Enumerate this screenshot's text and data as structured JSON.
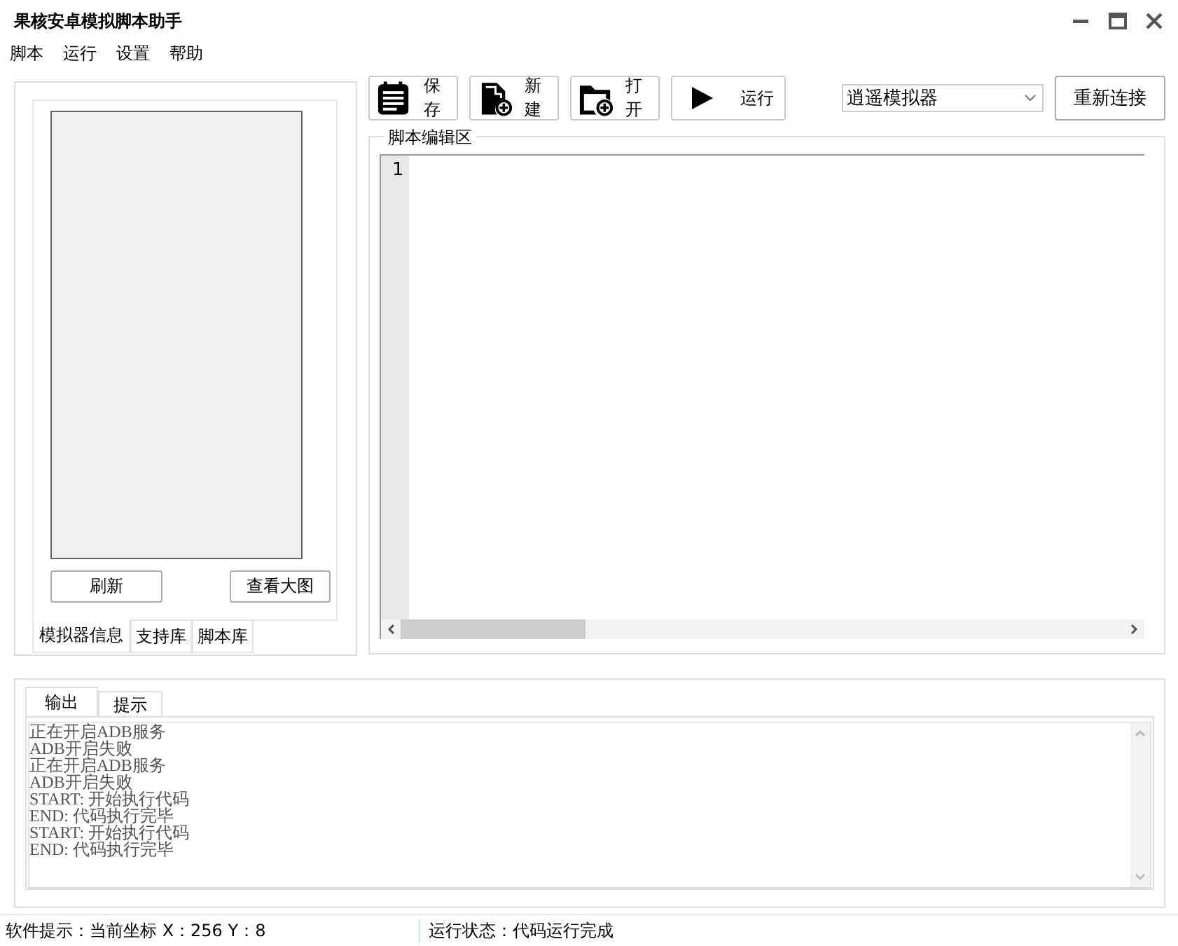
{
  "window": {
    "title": "果核安卓模拟脚本助手"
  },
  "menu": [
    "脚本",
    "运行",
    "设置",
    "帮助"
  ],
  "toolbar": [
    {
      "label": "保存",
      "kind": "save"
    },
    {
      "label": "新建",
      "kind": "new"
    },
    {
      "label": "打开",
      "kind": "open"
    },
    {
      "label": "运行",
      "kind": "run"
    }
  ],
  "emulator_select": {
    "value": "逍遥模拟器"
  },
  "reconnect_button": "重新连接",
  "preview": {
    "buttons": [
      "刷新",
      "查看大图"
    ],
    "tabs": [
      {
        "label": "模拟器信息",
        "selected": true
      },
      {
        "label": "支持库",
        "selected": false
      },
      {
        "label": "脚本库",
        "selected": false
      }
    ]
  },
  "editor": {
    "title": "脚本编辑区",
    "line_numbers": [
      "1"
    ]
  },
  "output": {
    "tabs": [
      {
        "label": "输出",
        "selected": true
      },
      {
        "label": "提示",
        "selected": false
      }
    ],
    "lines": [
      "正在开启ADB服务",
      "ADB开启失败",
      "正在开启ADB服务",
      "ADB开启失败",
      "START: 开始执行代码",
      "END: 代码执行完毕",
      "START: 开始执行代码",
      "END: 代码执行完毕"
    ]
  },
  "status_bar": {
    "hint": "软件提示：当前坐标 X：256 Y：8",
    "state": "运行状态：代码运行完成"
  }
}
